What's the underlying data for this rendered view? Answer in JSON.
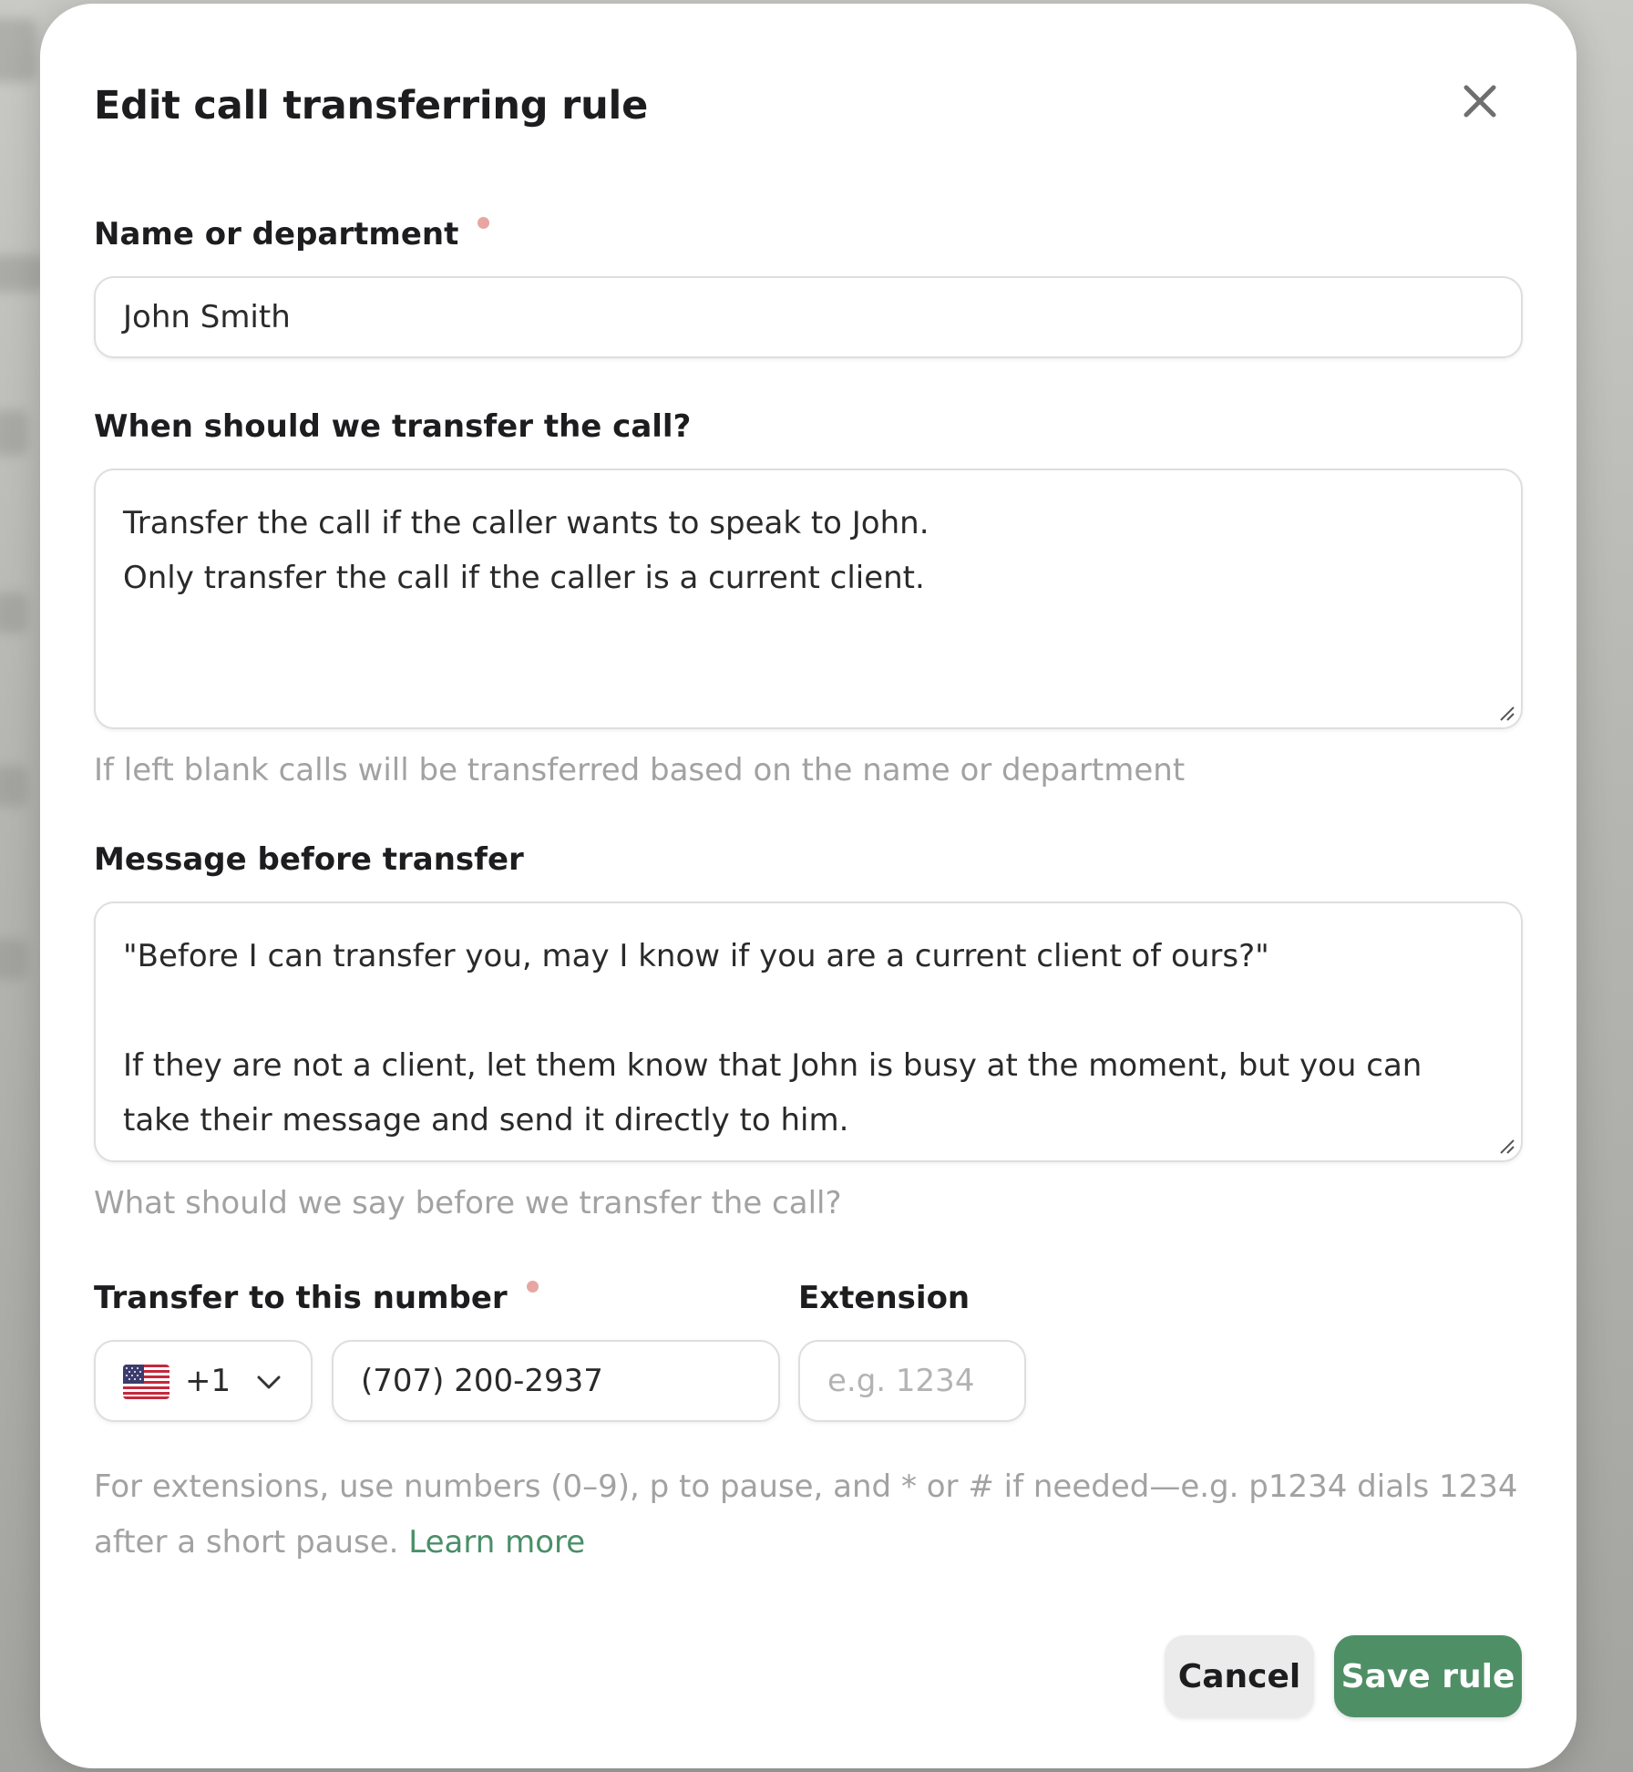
{
  "dialog": {
    "title": "Edit call transferring rule",
    "close_icon": "close-icon"
  },
  "name_field": {
    "label": "Name or department",
    "required": true,
    "value": "John Smith"
  },
  "when_field": {
    "label": "When should we transfer the call?",
    "value": "Transfer the call if the caller wants to speak to John.\nOnly transfer the call if the caller is a current client.",
    "helper": "If left blank calls will be transferred based on the name or department"
  },
  "message_field": {
    "label": "Message before transfer",
    "value": "\"Before I can transfer you, may I know if you are a current client of ours?\"\n\nIf they are not a client, let them know that John is busy at the moment, but you can take their message and send it directly to him.",
    "helper": "What should we say before we transfer the call?"
  },
  "transfer_number": {
    "label": "Transfer to this number",
    "required": true,
    "country_flag_icon": "us-flag-icon",
    "country_code": "+1",
    "dropdown_icon": "chevron-down-icon",
    "phone_value": "(707) 200-2937"
  },
  "extension": {
    "label": "Extension",
    "value": "",
    "placeholder": "e.g. 1234"
  },
  "extension_help": {
    "text": "For extensions, use numbers (0–9), p to pause, and * or # if needed—e.g. p1234 dials 1234 after a short pause. ",
    "link_label": "Learn more"
  },
  "actions": {
    "cancel_label": "Cancel",
    "save_label": "Save rule"
  },
  "colors": {
    "accent": "#4f8f66",
    "link": "#4a8f68",
    "required_dot": "#e8a6a2",
    "helper_text": "#a2a2a2"
  }
}
